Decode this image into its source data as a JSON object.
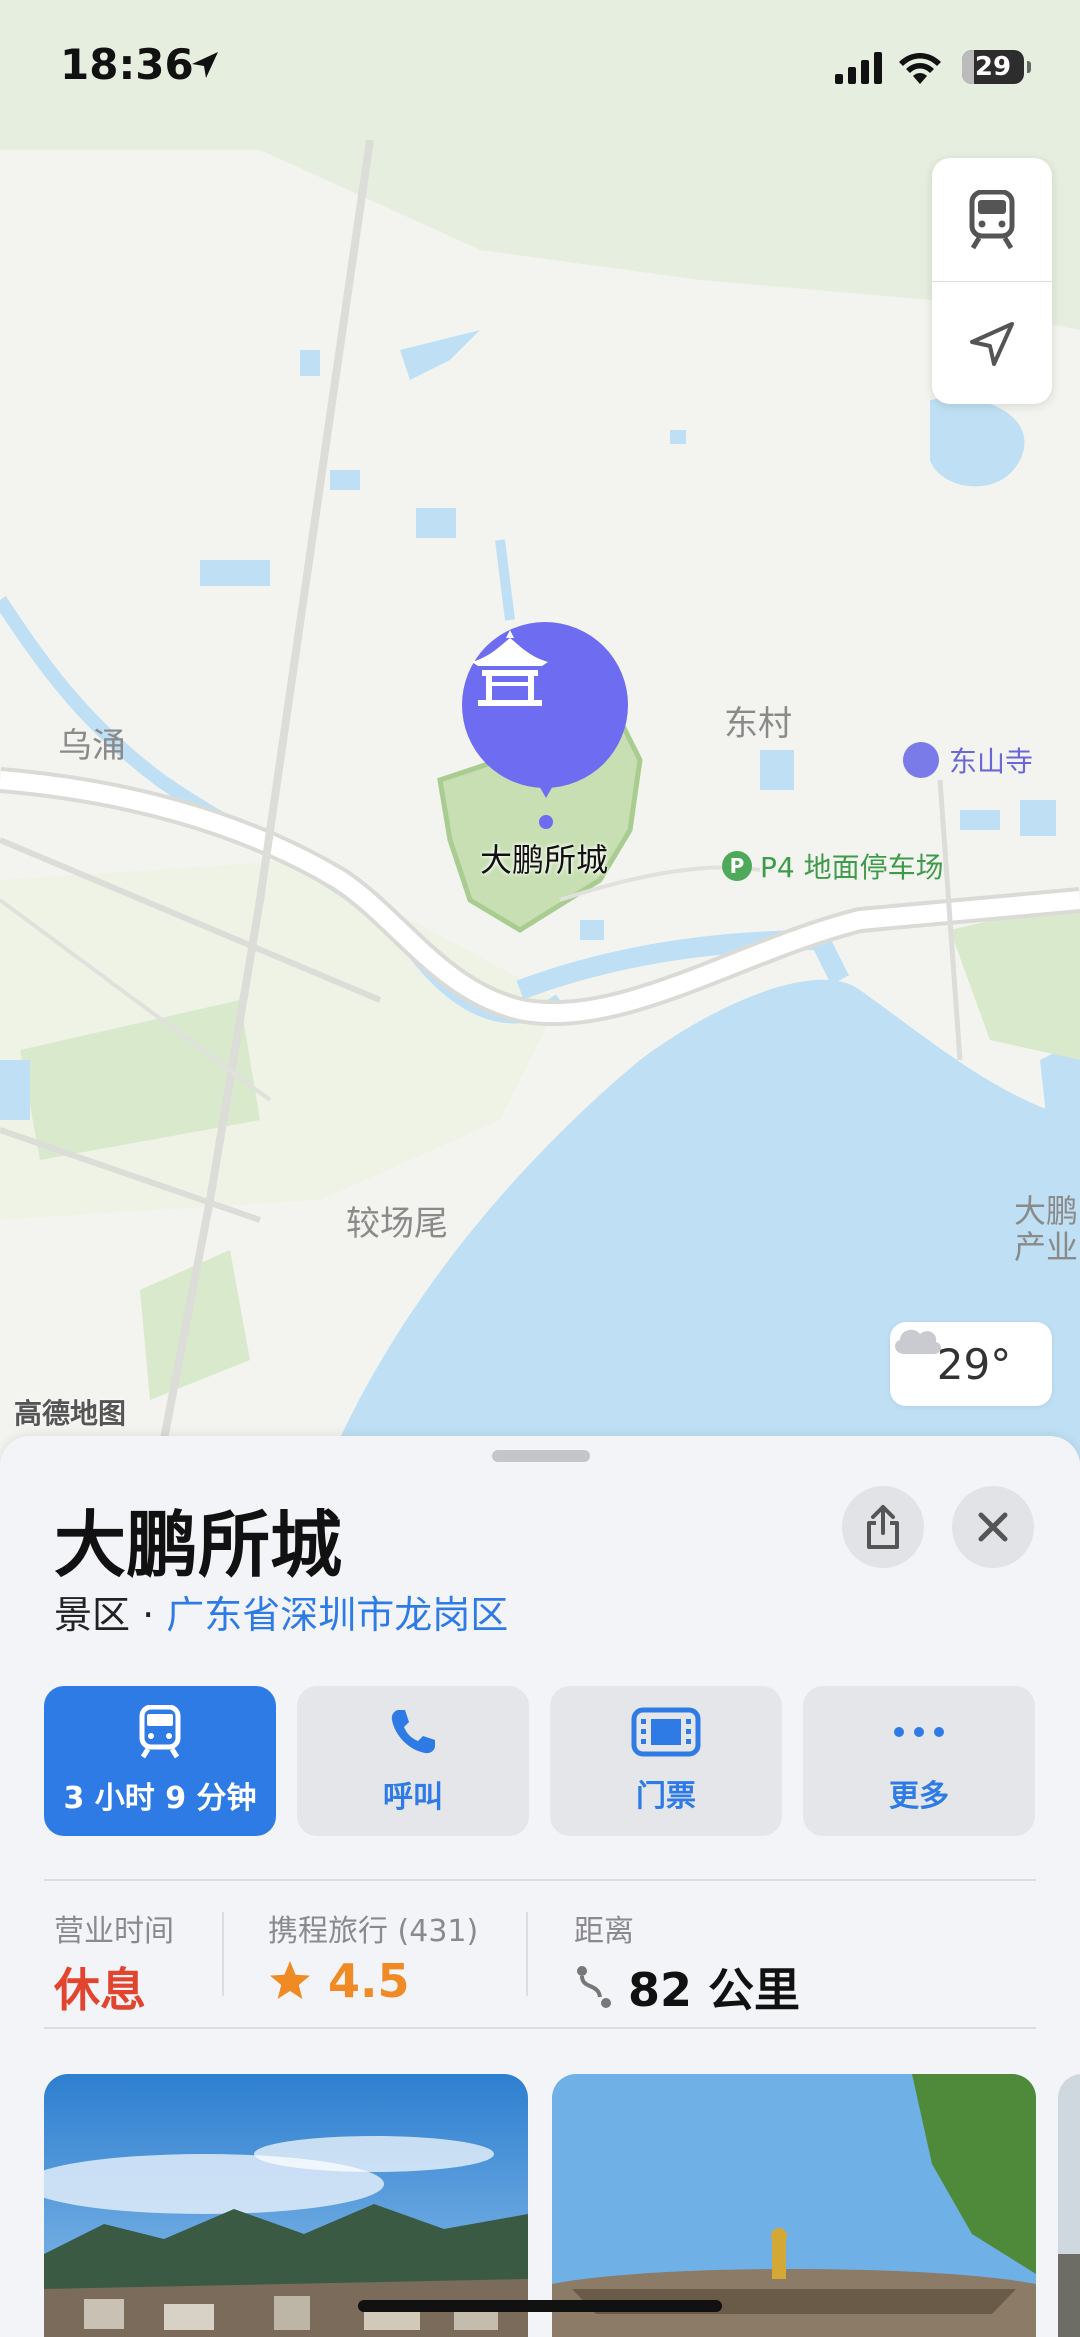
{
  "status_bar": {
    "time": "18:36",
    "battery": "29"
  },
  "map": {
    "labels": {
      "wuyong": "乌涌",
      "dongcun": "东村",
      "jiaochangwei": "较场尾",
      "dapeng_industry_line1": "大鹏",
      "dapeng_industry_line2": "产业"
    },
    "pin_label": "大鹏所城",
    "temple_label": "东山寺",
    "parking_label": "P4 地面停车场",
    "parking_badge": "P",
    "weather_temp": "29°",
    "provider": "高德地图",
    "colors": {
      "land": "#e6efdf",
      "water": "#bfe0f4",
      "park": "#c7dfb2",
      "road": "#ffffff",
      "pin": "#6e6cf0"
    }
  },
  "sheet": {
    "title": "大鹏所城",
    "category": "景区",
    "separator": " · ",
    "region": "广东省深圳市龙岗区",
    "actions": [
      {
        "label": "3 小时 9 分钟",
        "icon": "train-icon"
      },
      {
        "label": "呼叫",
        "icon": "phone-icon"
      },
      {
        "label": "门票",
        "icon": "ticket-icon"
      },
      {
        "label": "更多",
        "icon": "more-icon"
      }
    ],
    "info": {
      "hours_key": "营业时间",
      "hours_value": "休息",
      "rating_key": "携程旅行 (431)",
      "rating_value": "4.5",
      "distance_key": "距离",
      "distance_value": "82 公里"
    },
    "accent": "#2f7be5",
    "closed_color": "#e2452f",
    "star_color": "#f08a24"
  }
}
